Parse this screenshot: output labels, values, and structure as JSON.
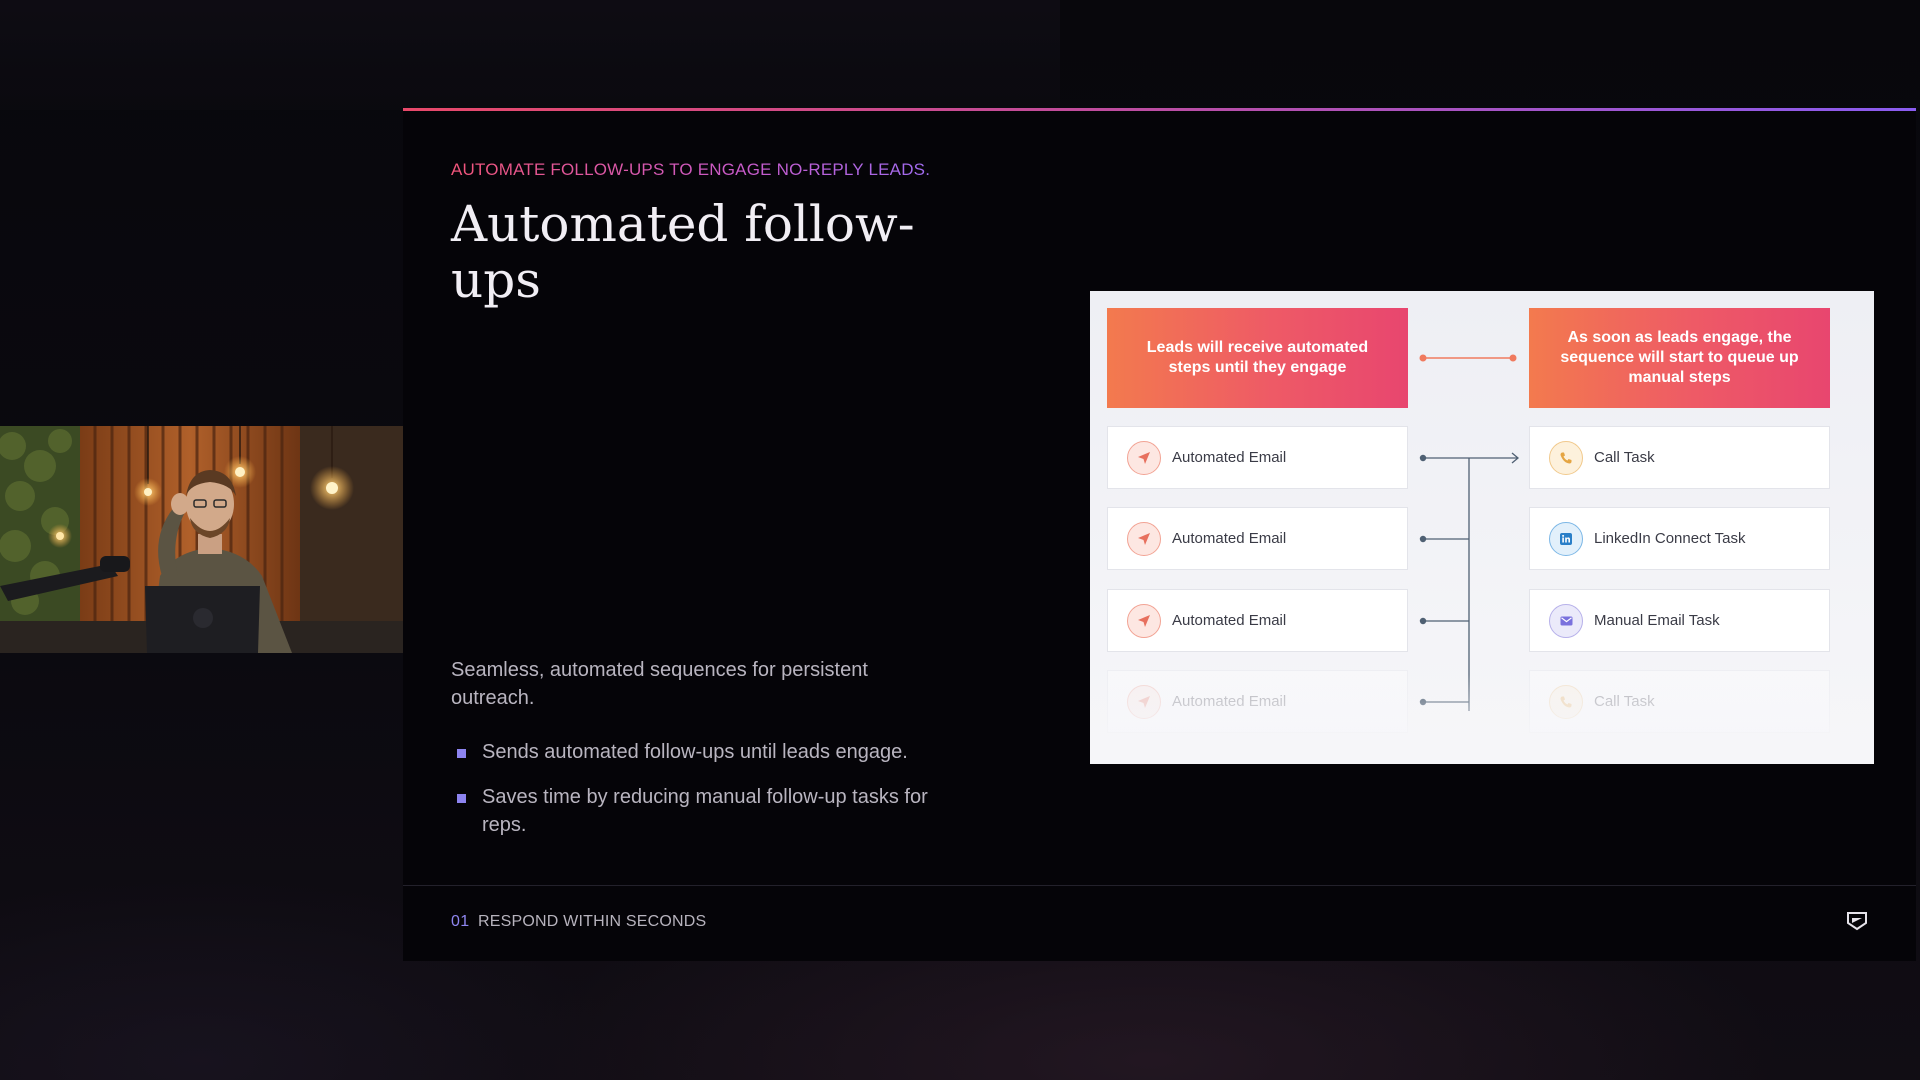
{
  "slide": {
    "eyebrow": "AUTOMATE FOLLOW-UPS TO ENGAGE NO-REPLY LEADS.",
    "title": "Automated follow-ups",
    "lead": "Seamless, automated sequences for persistent outreach.",
    "bullets": [
      "Sends automated follow-ups until leads engage.",
      "Saves time by reducing manual follow-up tasks for reps."
    ],
    "footer": {
      "number": "01",
      "label": "RESPOND WITHIN SECONDS",
      "logo_icon": "brand-logo-icon"
    }
  },
  "diagram": {
    "left_header": "Leads will receive automated steps until they engage",
    "right_header": "As soon as leads engage, the sequence will start to queue up manual steps",
    "left_steps": [
      {
        "label": "Automated Email",
        "icon": "send-icon"
      },
      {
        "label": "Automated Email",
        "icon": "send-icon"
      },
      {
        "label": "Automated Email",
        "icon": "send-icon"
      },
      {
        "label": "Automated Email",
        "icon": "send-icon"
      }
    ],
    "right_steps": [
      {
        "label": "Call Task",
        "icon": "phone-icon"
      },
      {
        "label": "LinkedIn Connect Task",
        "icon": "linkedin-icon"
      },
      {
        "label": "Manual Email Task",
        "icon": "mail-icon"
      },
      {
        "label": "Call Task",
        "icon": "phone-icon"
      }
    ],
    "colors": {
      "accent_orange": "#f37a4e",
      "accent_pink": "#e8466f",
      "connector": "#4f6073"
    }
  },
  "webcam": {
    "subject": "presenter-video"
  }
}
